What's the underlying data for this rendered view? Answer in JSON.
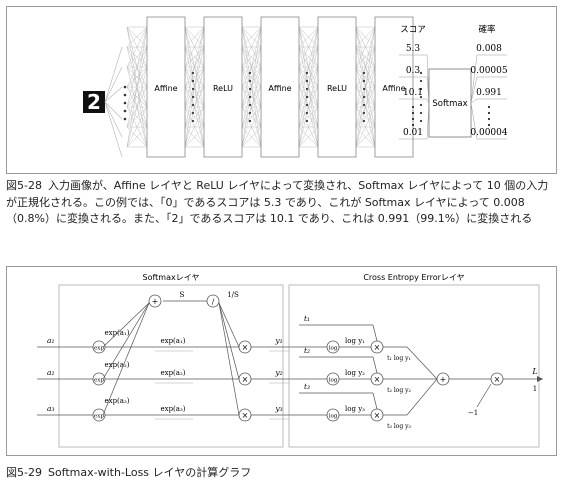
{
  "figure1": {
    "input_digit": "2",
    "layers": [
      "Affine",
      "ReLU",
      "Affine",
      "ReLU",
      "Affine"
    ],
    "softmax_label": "Softmax",
    "score_header": "スコア",
    "prob_header": "確率",
    "scores": [
      "5.3",
      "0.3",
      "10.1",
      "0.01"
    ],
    "probabilities": [
      "0.008",
      "0.00005",
      "0.991",
      "0.00004"
    ],
    "caption_number": "図5-28",
    "caption_text": "入力画像が、Affine レイヤと ReLU レイヤによって変換され、Softmax レイヤによって 10 個の入力が正規化される。この例では、「0」であるスコアは 5.3 であり、これが Softmax レイヤによって 0.008（0.8%）に変換される。また、「2」であるスコアは 10.1 であり、これは 0.991（99.1%）に変換される"
  },
  "figure2": {
    "softmax_title": "Softmaxレイヤ",
    "cee_title": "Cross Entropy Errorレイヤ",
    "inputs": [
      "a₁",
      "a₂",
      "a₃"
    ],
    "outputs_y": [
      "y₁",
      "y₂",
      "y₃"
    ],
    "teachers": [
      "t₁",
      "t₂",
      "t₃"
    ],
    "exp_nodes": [
      "exp(a₁)",
      "exp(a₂)",
      "exp(a₃)"
    ],
    "sum_label": "S",
    "inv_label": "1/S",
    "log_labels": [
      "log y₁",
      "log y₂",
      "log y₃"
    ],
    "mult_labels": [
      "t₁ log y₁",
      "t₂ log y₂",
      "t₃ log y₃"
    ],
    "loss_label": "L",
    "minus_one": "−1",
    "one": "1",
    "caption_number": "図5-29",
    "caption_text": "Softmax-with-Loss レイヤの計算グラフ"
  }
}
